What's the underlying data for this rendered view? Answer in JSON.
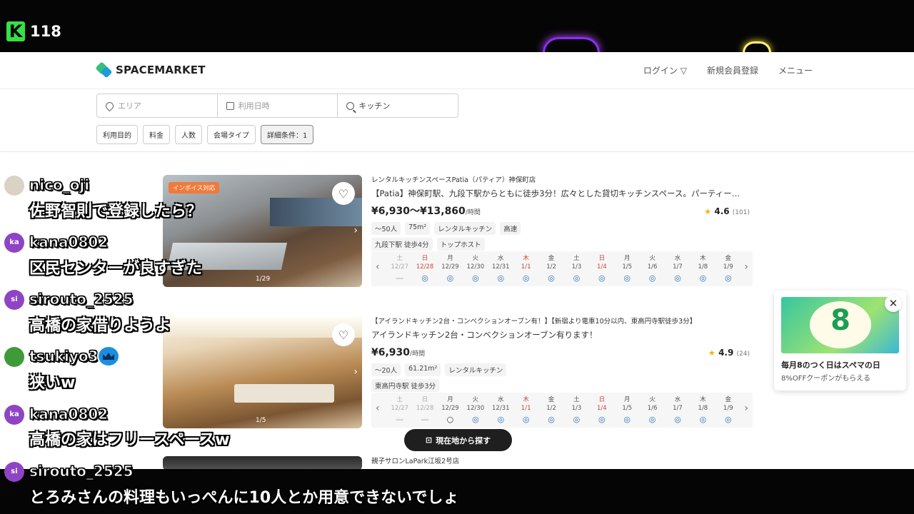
{
  "stream": {
    "viewer_count": "118",
    "logo_letter": "K"
  },
  "header": {
    "brand": "SPACEMARKET",
    "nav": {
      "login": "ログイン ▽",
      "signup": "新規会員登録",
      "menu": "メニュー"
    }
  },
  "search": {
    "area_placeholder": "エリア",
    "date_placeholder": "利用日時",
    "keyword": "キッチン"
  },
  "filters": [
    "利用目的",
    "料金",
    "人数",
    "会場タイプ",
    "詳細条件：1"
  ],
  "listings": [
    {
      "badge": "インボイス対応",
      "photo_counter": "1/29",
      "title": "レンタルキッチンスペースPatia（パティア）神保町店",
      "description": "【Patia】神保町駅、九段下駅からともに徒歩3分！広々とした貸切キッチンスペース。パーティー…",
      "price": "¥6,930〜¥13,860",
      "price_unit": "/時間",
      "rating": "4.6",
      "review_count": "(101)",
      "tags": [
        "〜50人",
        "75m²",
        "レンタルキッチン",
        "高速"
      ],
      "tags2": [
        "九段下駅 徒歩4分",
        "トップホスト"
      ],
      "calendar": [
        {
          "dow": "土",
          "date": "12/27",
          "status": "—",
          "sun": false,
          "muted": true
        },
        {
          "dow": "日",
          "date": "12/28",
          "status": "◎",
          "sun": true,
          "muted": false
        },
        {
          "dow": "月",
          "date": "12/29",
          "status": "◎",
          "sun": false,
          "muted": false
        },
        {
          "dow": "火",
          "date": "12/30",
          "status": "◎",
          "sun": false,
          "muted": false
        },
        {
          "dow": "水",
          "date": "12/31",
          "status": "◎",
          "sun": false,
          "muted": false
        },
        {
          "dow": "木",
          "date": "1/1",
          "status": "◎",
          "sun": true,
          "muted": false
        },
        {
          "dow": "金",
          "date": "1/2",
          "status": "◎",
          "sun": false,
          "muted": false
        },
        {
          "dow": "土",
          "date": "1/3",
          "status": "◎",
          "sun": false,
          "muted": false
        },
        {
          "dow": "日",
          "date": "1/4",
          "status": "◎",
          "sun": true,
          "muted": false
        },
        {
          "dow": "月",
          "date": "1/5",
          "status": "◎",
          "sun": false,
          "muted": false
        },
        {
          "dow": "火",
          "date": "1/6",
          "status": "◎",
          "sun": false,
          "muted": false
        },
        {
          "dow": "水",
          "date": "1/7",
          "status": "◎",
          "sun": false,
          "muted": false
        },
        {
          "dow": "木",
          "date": "1/8",
          "status": "◎",
          "sun": false,
          "muted": false
        },
        {
          "dow": "金",
          "date": "1/9",
          "status": "◎",
          "sun": false,
          "muted": false
        }
      ]
    },
    {
      "photo_counter": "1/5",
      "title": "【アイランドキッチン2台・コンベクションオーブン有！】【新宿より電車10分以内、東高円寺駅徒歩3分】",
      "description": "アイランドキッチン2台・コンベクションオーブン有ります！",
      "price": "¥6,930",
      "price_unit": "/時間",
      "rating": "4.9",
      "review_count": "(24)",
      "tags": [
        "〜20人",
        "61.21m²",
        "レンタルキッチン"
      ],
      "tags2": [
        "東高円寺駅 徒歩3分"
      ],
      "calendar": [
        {
          "dow": "土",
          "date": "12/27",
          "status": "—",
          "sun": false,
          "muted": true
        },
        {
          "dow": "日",
          "date": "12/28",
          "status": "—",
          "sun": false,
          "muted": true
        },
        {
          "dow": "月",
          "date": "12/29",
          "status": "○",
          "sun": false,
          "muted": false
        },
        {
          "dow": "火",
          "date": "12/30",
          "status": "◎",
          "sun": false,
          "muted": false
        },
        {
          "dow": "水",
          "date": "12/31",
          "status": "◎",
          "sun": false,
          "muted": false
        },
        {
          "dow": "木",
          "date": "1/1",
          "status": "◎",
          "sun": true,
          "muted": false
        },
        {
          "dow": "金",
          "date": "1/2",
          "status": "◎",
          "sun": false,
          "muted": false
        },
        {
          "dow": "土",
          "date": "1/3",
          "status": "◎",
          "sun": false,
          "muted": false
        },
        {
          "dow": "日",
          "date": "1/4",
          "status": "◎",
          "sun": true,
          "muted": false
        },
        {
          "dow": "月",
          "date": "1/5",
          "status": "◎",
          "sun": false,
          "muted": false
        },
        {
          "dow": "火",
          "date": "1/6",
          "status": "◎",
          "sun": false,
          "muted": false
        },
        {
          "dow": "水",
          "date": "1/7",
          "status": "◎",
          "sun": false,
          "muted": false
        },
        {
          "dow": "木",
          "date": "1/8",
          "status": "◎",
          "sun": false,
          "muted": false
        },
        {
          "dow": "金",
          "date": "1/9",
          "status": "◎",
          "sun": false,
          "muted": false
        }
      ]
    },
    {
      "title": "親子サロンLaPark江坂2号店"
    }
  ],
  "fab_label": "現在地から探す",
  "promo": {
    "image_text": "8",
    "title": "毎月8のつく日はスペマの日",
    "subtitle": "8%OFFクーポンがもらえる"
  },
  "chat": [
    {
      "user": "nico_oji",
      "text": "佐野智則で登録したら？",
      "avatar_color": "#d9d2c5",
      "avatar_text": ""
    },
    {
      "user": "kana0802",
      "text": "区民センターが良すぎた",
      "avatar_color": "#8e44c4",
      "avatar_text": "ka"
    },
    {
      "user": "sirouto_2525",
      "text": "高橋の家借りようよ",
      "avatar_color": "#8e44c4",
      "avatar_text": "si"
    },
    {
      "user": "tsukiyo3",
      "text": "狭いw",
      "avatar_color": "#3f9a3a",
      "avatar_text": ""
    },
    {
      "user": "kana0802",
      "text": "高橋の家はフリースペースw",
      "avatar_color": "#8e44c4",
      "avatar_text": "ka"
    },
    {
      "user": "sirouto_2525",
      "text": "とろみさんの料理もいっぺんに10人とか用意できないでしょ",
      "avatar_color": "#8e44c4",
      "avatar_text": "si"
    }
  ]
}
